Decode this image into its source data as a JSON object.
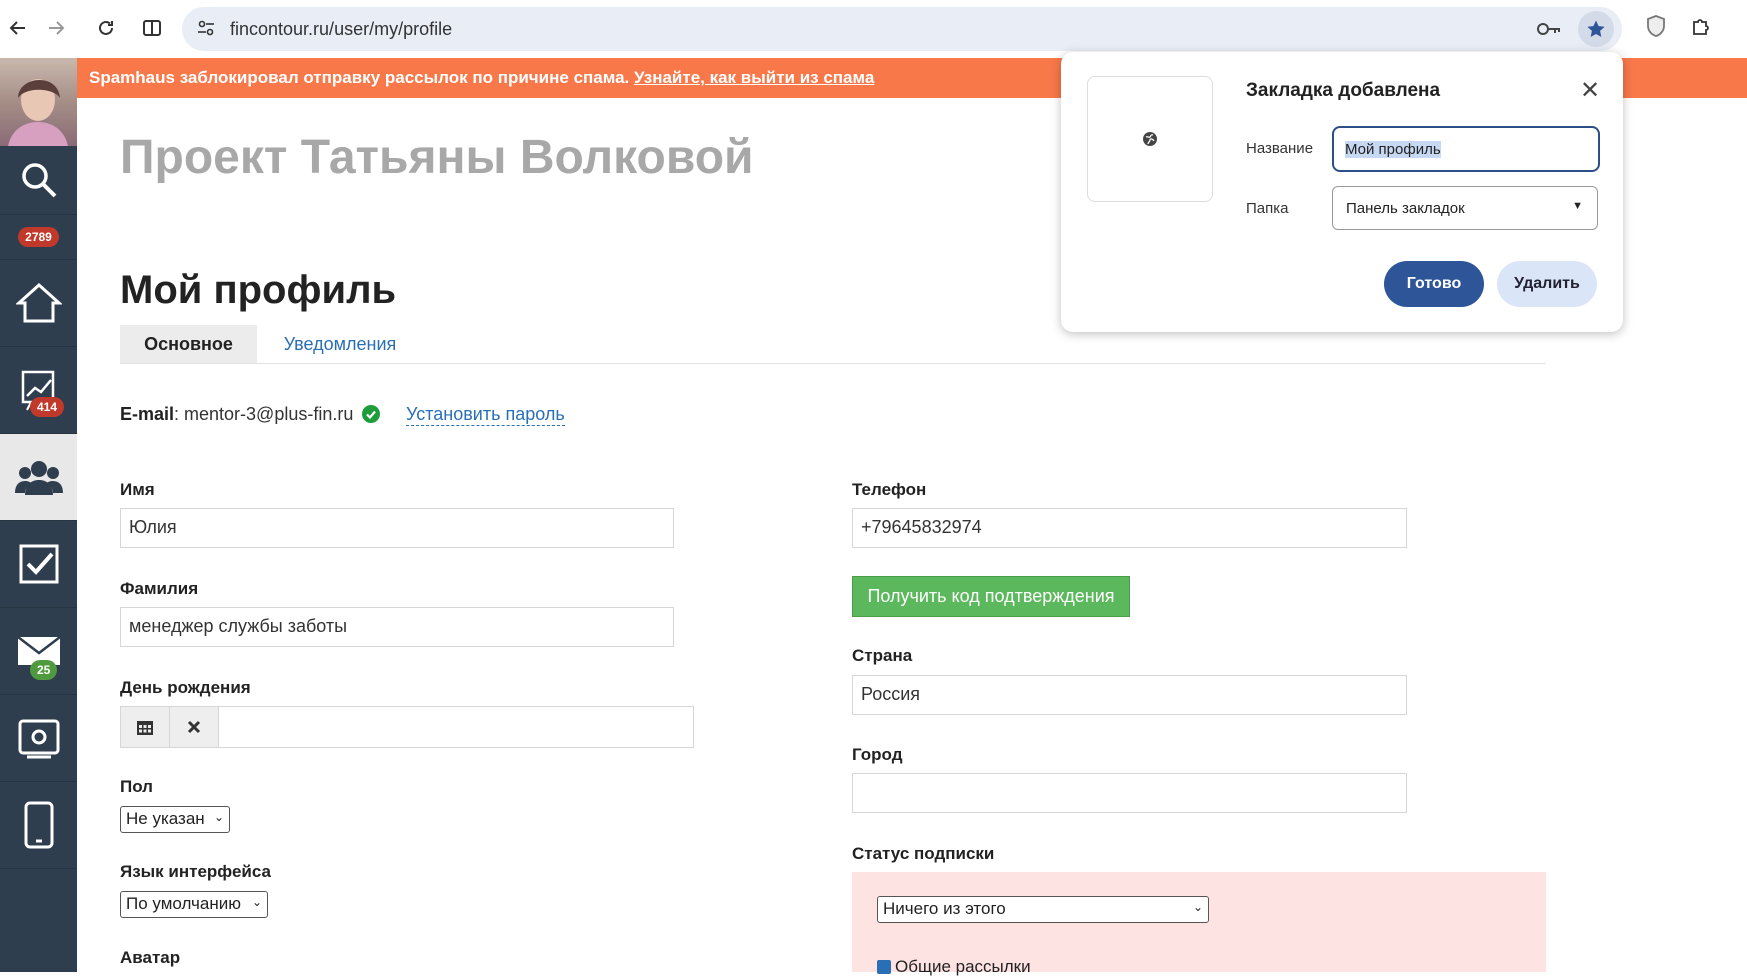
{
  "browser": {
    "url": "fincontour.ru/user/my/profile"
  },
  "sidebar": {
    "badges": {
      "notifications": "2789",
      "analytics": "414",
      "mail": "25"
    }
  },
  "banner": {
    "text": "Spamhaus заблокировал отправку рассылок по причине спама. ",
    "link": "Узнайте, как выйти из спама"
  },
  "page": {
    "project_title": "Проект Татьяны Волковой",
    "title": "Мой профиль",
    "tabs": [
      "Основное",
      "Уведомления"
    ]
  },
  "email": {
    "label": "E-mail",
    "value": ": mentor-3@plus-fin.ru",
    "set_password": "Установить пароль"
  },
  "form": {
    "first_name_label": "Имя",
    "first_name": "Юлия",
    "last_name_label": "Фамилия",
    "last_name": "менеджер службы заботы",
    "birthday_label": "День рождения",
    "gender_label": "Пол",
    "gender_value": "Не указан",
    "lang_label": "Язык интерфейса",
    "lang_value": "По умолчанию",
    "avatar_label": "Аватар",
    "phone_label": "Телефон",
    "phone": "+79645832974",
    "get_code": "Получить код подтверждения",
    "country_label": "Страна",
    "country": "Россия",
    "city_label": "Город",
    "city": "",
    "subscription_label": "Статус подписки",
    "subscription_value": "Ничего из этого",
    "general_mailings": "Общие рассылки"
  },
  "bookmark_popup": {
    "title": "Закладка добавлена",
    "name_label": "Название",
    "name_value": "Мой профиль",
    "folder_label": "Папка",
    "folder_value": "Панель закладок",
    "done": "Готово",
    "delete": "Удалить"
  }
}
